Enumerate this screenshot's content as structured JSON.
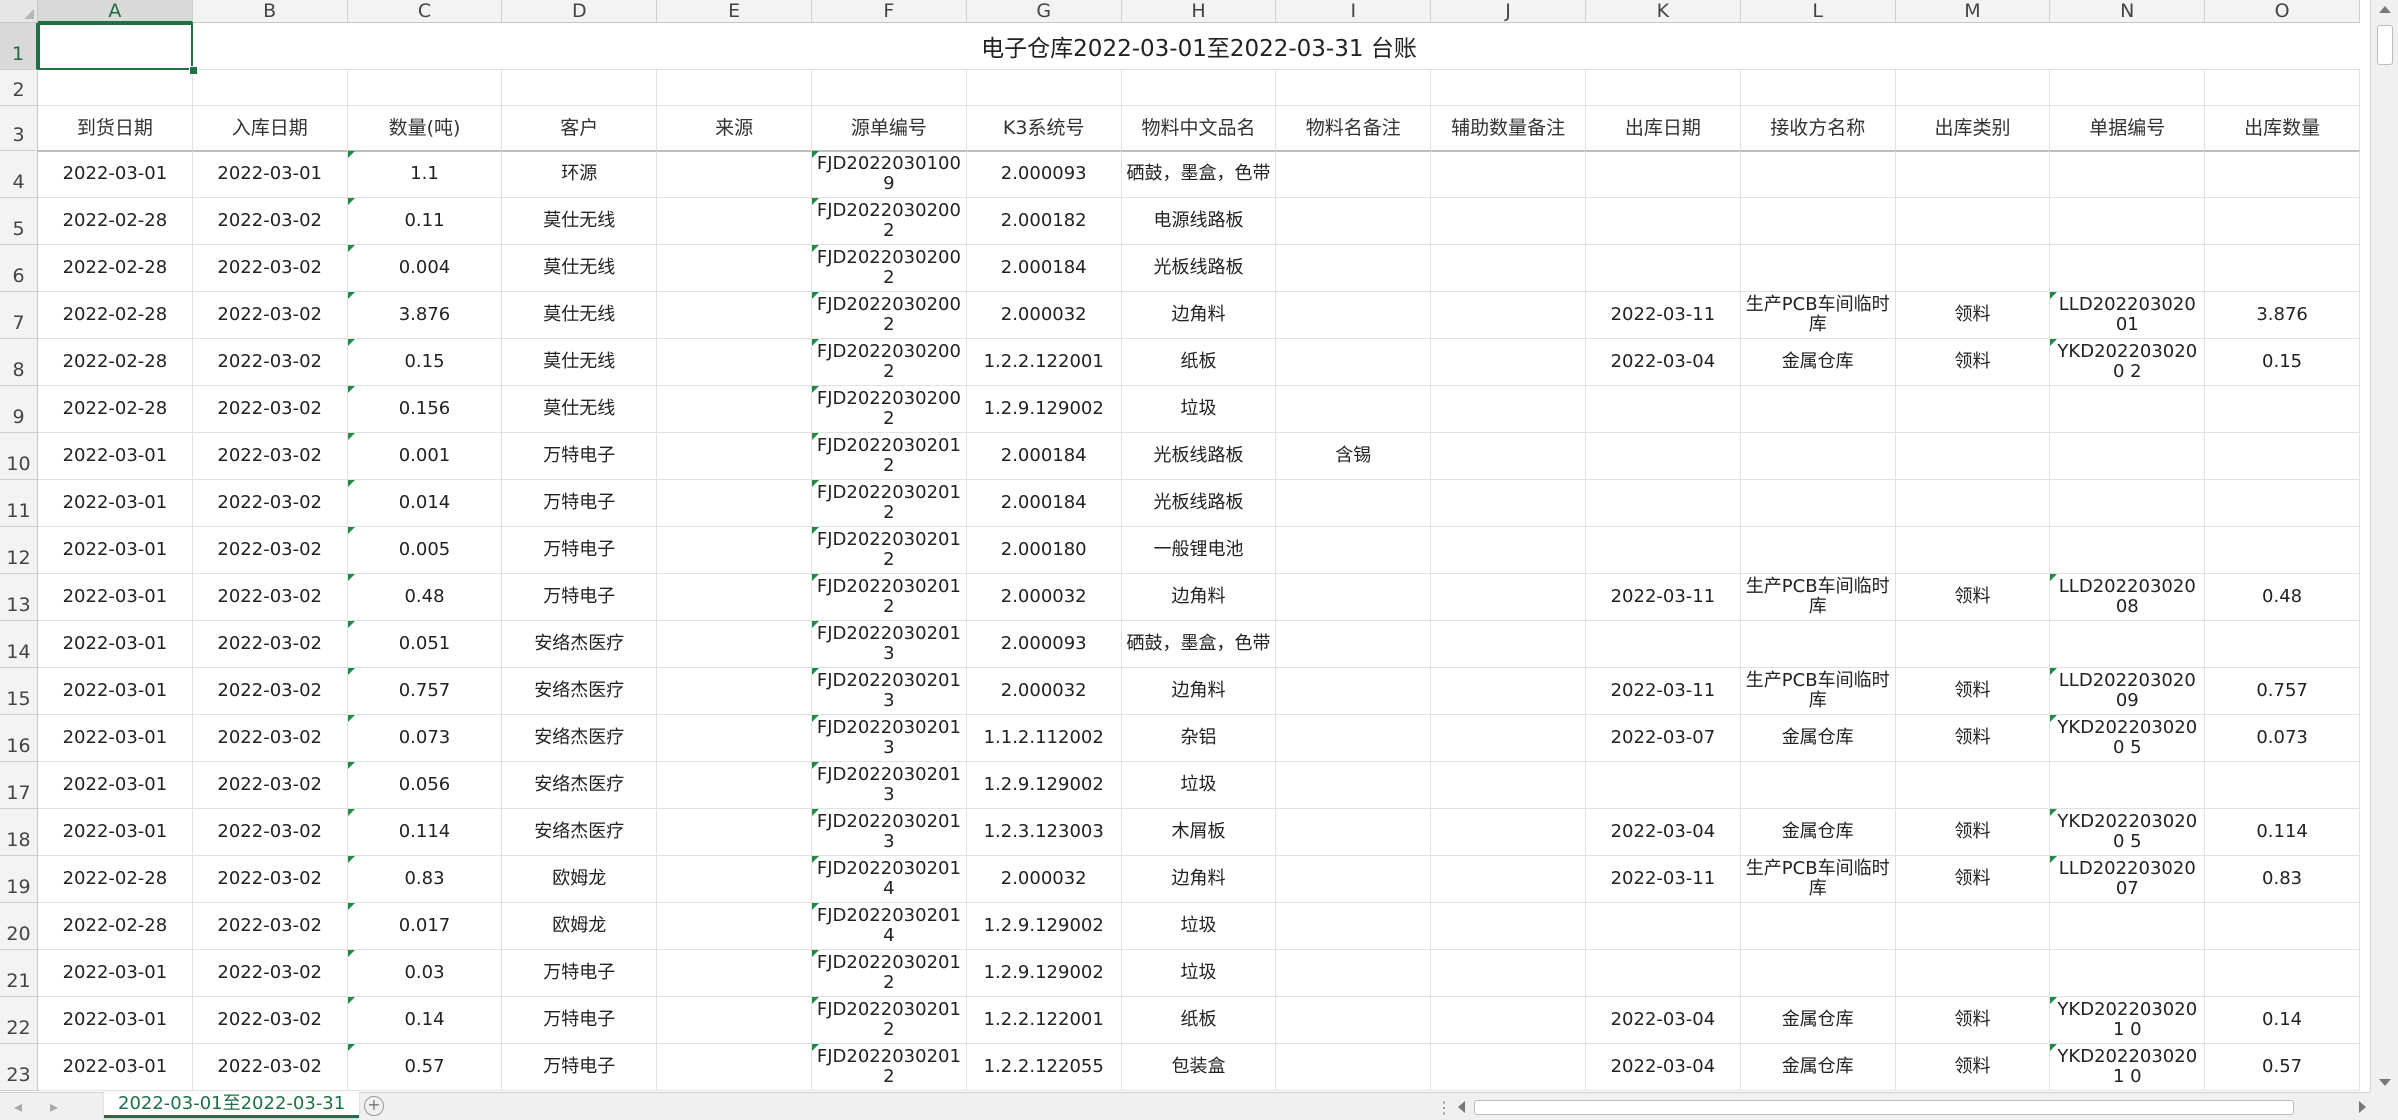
{
  "columns": [
    "A",
    "B",
    "C",
    "D",
    "E",
    "F",
    "G",
    "H",
    "I",
    "J",
    "K",
    "L",
    "M",
    "N",
    "O"
  ],
  "selected_column": "A",
  "selected_row": "1",
  "rows_numbers": [
    "1",
    "2",
    "3",
    "4",
    "5",
    "6",
    "7",
    "8",
    "9",
    "10",
    "11",
    "12",
    "13",
    "14",
    "15",
    "16",
    "17",
    "18",
    "19",
    "20",
    "21",
    "22",
    "23"
  ],
  "title": "电子仓库2022-03-01至2022-03-31 台账",
  "headers": [
    "到货日期",
    "入库日期",
    "数量(吨)",
    "客户",
    "来源",
    "源单编号",
    "K3系统号",
    "物料中文品名",
    "物料名备注",
    "辅助数量备注",
    "出库日期",
    "接收方名称",
    "出库类别",
    "单据编号",
    "出库数量"
  ],
  "rows": [
    [
      "2022-03-01",
      "2022-03-01",
      "1.1",
      "环源",
      "",
      "FJD20220301009",
      "2.000093",
      "硒鼓，墨盒，色带",
      "",
      "",
      "",
      "",
      "",
      "",
      ""
    ],
    [
      "2022-02-28",
      "2022-03-02",
      "0.11",
      "莫仕无线",
      "",
      "FJD20220302002",
      "2.000182",
      "电源线路板",
      "",
      "",
      "",
      "",
      "",
      "",
      ""
    ],
    [
      "2022-02-28",
      "2022-03-02",
      "0.004",
      "莫仕无线",
      "",
      "FJD20220302002",
      "2.000184",
      "光板线路板",
      "",
      "",
      "",
      "",
      "",
      "",
      ""
    ],
    [
      "2022-02-28",
      "2022-03-02",
      "3.876",
      "莫仕无线",
      "",
      "FJD20220302002",
      "2.000032",
      "边角料",
      "",
      "",
      "2022-03-11",
      "生产PCB车间临时库",
      "领料",
      "LLD20220302001",
      "3.876"
    ],
    [
      "2022-02-28",
      "2022-03-02",
      "0.15",
      "莫仕无线",
      "",
      "FJD20220302002",
      "1.2.2.122001",
      "纸板",
      "",
      "",
      "2022-03-04",
      "金属仓库",
      "领料",
      "YKD2022030200 2",
      "0.15"
    ],
    [
      "2022-02-28",
      "2022-03-02",
      "0.156",
      "莫仕无线",
      "",
      "FJD20220302002",
      "1.2.9.129002",
      "垃圾",
      "",
      "",
      "",
      "",
      "",
      "",
      ""
    ],
    [
      "2022-03-01",
      "2022-03-02",
      "0.001",
      "万特电子",
      "",
      "FJD20220302012",
      "2.000184",
      "光板线路板",
      "含锡",
      "",
      "",
      "",
      "",
      "",
      ""
    ],
    [
      "2022-03-01",
      "2022-03-02",
      "0.014",
      "万特电子",
      "",
      "FJD20220302012",
      "2.000184",
      "光板线路板",
      "",
      "",
      "",
      "",
      "",
      "",
      ""
    ],
    [
      "2022-03-01",
      "2022-03-02",
      "0.005",
      "万特电子",
      "",
      "FJD20220302012",
      "2.000180",
      "一般锂电池",
      "",
      "",
      "",
      "",
      "",
      "",
      ""
    ],
    [
      "2022-03-01",
      "2022-03-02",
      "0.48",
      "万特电子",
      "",
      "FJD20220302012",
      "2.000032",
      "边角料",
      "",
      "",
      "2022-03-11",
      "生产PCB车间临时库",
      "领料",
      "LLD20220302008",
      "0.48"
    ],
    [
      "2022-03-01",
      "2022-03-02",
      "0.051",
      "安络杰医疗",
      "",
      "FJD20220302013",
      "2.000093",
      "硒鼓，墨盒，色带",
      "",
      "",
      "",
      "",
      "",
      "",
      ""
    ],
    [
      "2022-03-01",
      "2022-03-02",
      "0.757",
      "安络杰医疗",
      "",
      "FJD20220302013",
      "2.000032",
      "边角料",
      "",
      "",
      "2022-03-11",
      "生产PCB车间临时库",
      "领料",
      "LLD20220302009",
      "0.757"
    ],
    [
      "2022-03-01",
      "2022-03-02",
      "0.073",
      "安络杰医疗",
      "",
      "FJD20220302013",
      "1.1.2.112002",
      "杂铝",
      "",
      "",
      "2022-03-07",
      "金属仓库",
      "领料",
      "YKD2022030200 5",
      "0.073"
    ],
    [
      "2022-03-01",
      "2022-03-02",
      "0.056",
      "安络杰医疗",
      "",
      "FJD20220302013",
      "1.2.9.129002",
      "垃圾",
      "",
      "",
      "",
      "",
      "",
      "",
      ""
    ],
    [
      "2022-03-01",
      "2022-03-02",
      "0.114",
      "安络杰医疗",
      "",
      "FJD20220302013",
      "1.2.3.123003",
      "木屑板",
      "",
      "",
      "2022-03-04",
      "金属仓库",
      "领料",
      "YKD2022030200 5",
      "0.114"
    ],
    [
      "2022-02-28",
      "2022-03-02",
      "0.83",
      "欧姆龙",
      "",
      "FJD20220302014",
      "2.000032",
      "边角料",
      "",
      "",
      "2022-03-11",
      "生产PCB车间临时库",
      "领料",
      "LLD20220302007",
      "0.83"
    ],
    [
      "2022-02-28",
      "2022-03-02",
      "0.017",
      "欧姆龙",
      "",
      "FJD20220302014",
      "1.2.9.129002",
      "垃圾",
      "",
      "",
      "",
      "",
      "",
      "",
      ""
    ],
    [
      "2022-03-01",
      "2022-03-02",
      "0.03",
      "万特电子",
      "",
      "FJD20220302012",
      "1.2.9.129002",
      "垃圾",
      "",
      "",
      "",
      "",
      "",
      "",
      ""
    ],
    [
      "2022-03-01",
      "2022-03-02",
      "0.14",
      "万特电子",
      "",
      "FJD20220302012",
      "1.2.2.122001",
      "纸板",
      "",
      "",
      "2022-03-04",
      "金属仓库",
      "领料",
      "YKD2022030201 0",
      "0.14"
    ],
    [
      "2022-03-01",
      "2022-03-02",
      "0.57",
      "万特电子",
      "",
      "FJD20220302012",
      "1.2.2.122055",
      "包装盒",
      "",
      "",
      "2022-03-04",
      "金属仓库",
      "领料",
      "YKD2022030201 0",
      "0.57"
    ]
  ],
  "sheet_tab": "2022-03-01至2022-03-31",
  "icons": {
    "add_sheet": "plus-circle-icon",
    "tab_prev": "tab-prev-icon",
    "tab_next": "tab-next-icon",
    "more": "vertical-dots-icon"
  },
  "colors": {
    "accent": "#1e7145",
    "marker": "#1e8c45",
    "grid": "#e1e1e1",
    "header_bg": "#f3f3f3"
  }
}
